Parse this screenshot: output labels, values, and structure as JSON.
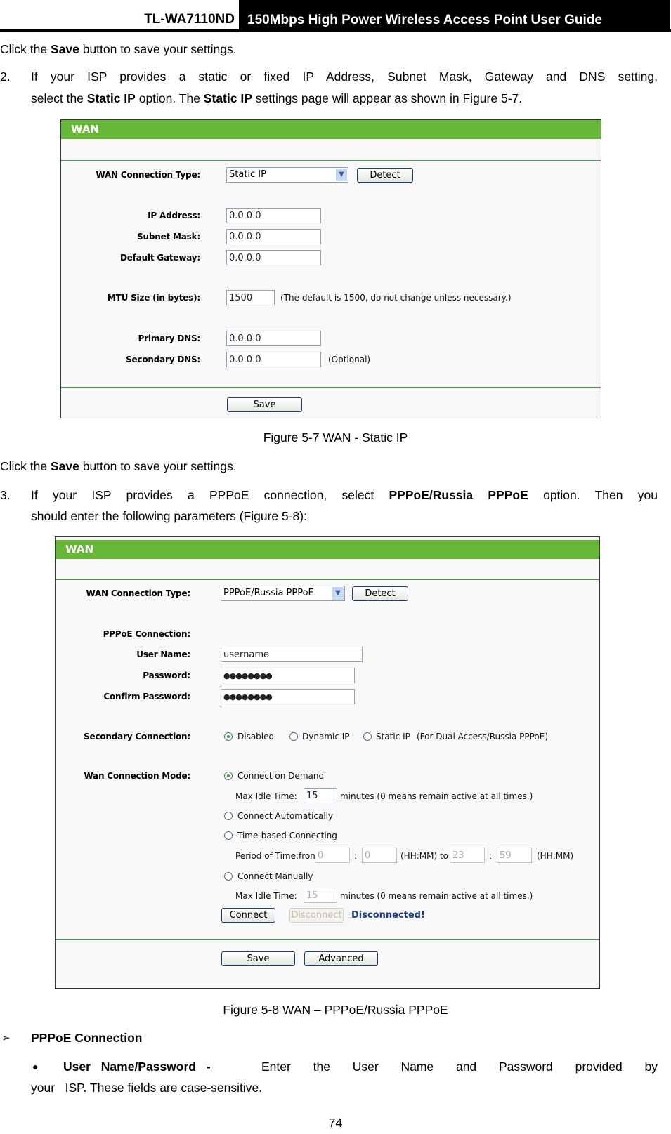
{
  "header": {
    "model": "TL-WA7110ND",
    "title": "150Mbps High Power Wireless Access Point User Guide"
  },
  "para1": {
    "pre": "Click the ",
    "bold": "Save",
    "post": " button to save your settings."
  },
  "step2": {
    "number": "2.",
    "line1": "If your ISP provides a static or fixed IP Address, Subnet Mask, Gateway and DNS setting,",
    "line2_pre": "select the ",
    "line2_bold1": "Static IP",
    "line2_mid": " option. The ",
    "line2_bold2": "Static IP",
    "line2_post": " settings page will appear as shown in Figure 5-7."
  },
  "figure7": {
    "panel_title": "WAN",
    "connection_type_label": "WAN Connection Type:",
    "connection_type_value": "Static IP",
    "detect_label": "Detect",
    "ip_label": "IP Address:",
    "ip_value": "0.0.0.0",
    "mask_label": "Subnet Mask:",
    "mask_value": "0.0.0.0",
    "gateway_label": "Default Gateway:",
    "gateway_value": "0.0.0.0",
    "mtu_label": "MTU Size (in bytes):",
    "mtu_value": "1500",
    "mtu_note": "(The default is 1500, do not change unless necessary.)",
    "dns1_label": "Primary DNS:",
    "dns1_value": "0.0.0.0",
    "dns2_label": "Secondary DNS:",
    "dns2_value": "0.0.0.0",
    "dns2_note": "(Optional)",
    "save_label": "Save",
    "caption": "Figure 5-7 WAN - Static IP"
  },
  "para2": {
    "pre": "Click the ",
    "bold": "Save",
    "post": " button to save your settings."
  },
  "step3": {
    "number": "3.",
    "line1_pre": "If your ISP provides a PPPoE connection, select ",
    "line1_bold": "PPPoE/Russia PPPoE",
    "line1_post": " option. Then you",
    "line2": "should enter the following parameters (Figure 5-8):"
  },
  "figure8": {
    "panel_title": "WAN",
    "connection_type_label": "WAN Connection Type:",
    "connection_type_value": "PPPoE/Russia PPPoE",
    "detect_label": "Detect",
    "pppoe_label": "PPPoE Connection:",
    "username_label": "User Name:",
    "username_value": "username",
    "password_label": "Password:",
    "password_value": "●●●●●●●●",
    "confirm_label": "Confirm Password:",
    "confirm_value": "●●●●●●●●",
    "secondary_label": "Secondary Connection:",
    "secondary_options": [
      "Disabled",
      "Dynamic IP",
      "Static IP"
    ],
    "secondary_selected": "Disabled",
    "secondary_note": "(For Dual Access/Russia PPPoE)",
    "mode_label": "Wan Connection Mode:",
    "mode_options": [
      "Connect on Demand",
      "Connect Automatically",
      "Time-based Connecting",
      "Connect Manually"
    ],
    "mode_selected": "Connect on Demand",
    "idle1_label": "Max Idle Time:",
    "idle1_value": "15",
    "idle1_note": "minutes (0 means remain active at all times.)",
    "period_label": "Period of Time:from",
    "from_hh": "0",
    "from_mm": "0",
    "colon": ":",
    "hhmm_to": "(HH:MM) to",
    "to_hh": "23",
    "to_mm": "59",
    "hhmm": "(HH:MM)",
    "idle2_label": "Max Idle Time:",
    "idle2_value": "15",
    "idle2_note": "minutes (0 means remain active at all times.)",
    "connect_label": "Connect",
    "disconnect_label": "Disconnect",
    "status_text": "Disconnected!",
    "save_label": "Save",
    "advanced_label": "Advanced",
    "caption": "Figure 5-8 WAN – PPPoE/Russia PPPoE"
  },
  "section": {
    "bullet": "➢",
    "title": "PPPoE Connection",
    "item_bullet": "●",
    "item_bold": "User Name/Password -",
    "item_text1": "Enter the User Name and Password provided by",
    "item_text2": "your   ISP. These fields are case-sensitive."
  },
  "footer": {
    "page_number": "74"
  },
  "colors": {
    "panel_bar": "#67b637",
    "status": "#1b3d8a"
  }
}
